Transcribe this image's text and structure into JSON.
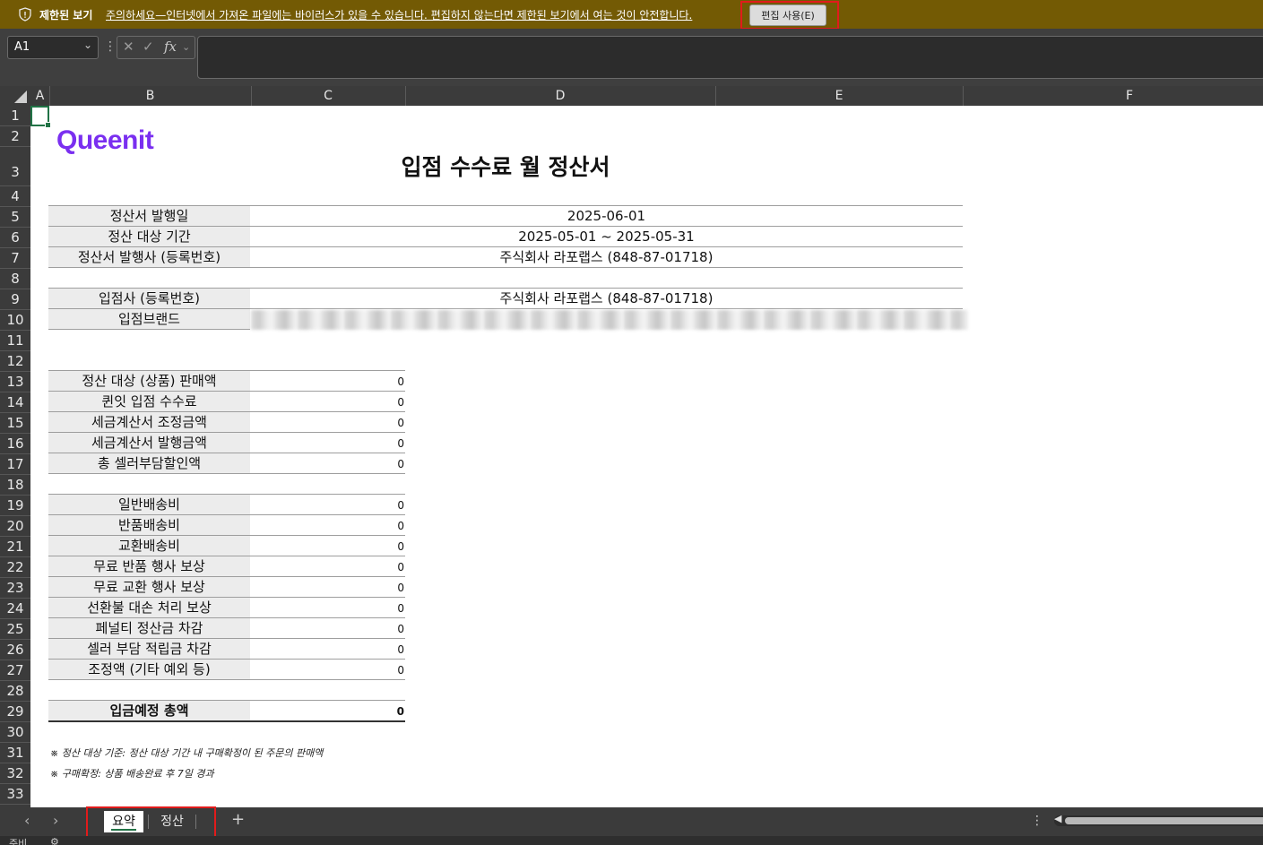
{
  "protected_view": {
    "title": "제한된 보기",
    "message": "주의하세요—인터넷에서 가져온 파일에는 바이러스가 있을 수 있습니다. 편집하지 않는다면 제한된 보기에서 여는 것이 안전합니다.",
    "enable_button": "편집 사용(E)",
    "bar_color": "#735a04"
  },
  "formula_bar": {
    "name_box": "A1",
    "fx_label": "fx",
    "formula": ""
  },
  "columns": [
    "A",
    "B",
    "C",
    "D",
    "E",
    "F"
  ],
  "rows": [
    "1",
    "2",
    "3",
    "4",
    "5",
    "6",
    "7",
    "8",
    "9",
    "10",
    "11",
    "12",
    "13",
    "14",
    "15",
    "16",
    "17",
    "18",
    "19",
    "20",
    "21",
    "22",
    "23",
    "24",
    "25",
    "26",
    "27",
    "28",
    "29",
    "30",
    "31",
    "32",
    "33"
  ],
  "sheet": {
    "logo": "Queenit",
    "logo_color": "#7a2ff0",
    "title": "입점 수수료 월 정산서",
    "info": [
      {
        "label": "정산서 발행일",
        "value": "2025-06-01"
      },
      {
        "label": "정산 대상 기간",
        "value": "2025-05-01 ~ 2025-05-31"
      },
      {
        "label": "정산서 발행사 (등록번호)",
        "value": "주식회사 라포랩스 (848-87-01718)"
      },
      {
        "label": "입점사 (등록번호)",
        "value": "주식회사 라포랩스 (848-87-01718)"
      },
      {
        "label": "입점브랜드",
        "value": ""
      }
    ],
    "sales": [
      {
        "label": "정산 대상 (상품) 판매액",
        "value": "0"
      },
      {
        "label": "퀸잇 입점 수수료",
        "value": "0"
      },
      {
        "label": "세금계산서 조정금액",
        "value": "0"
      },
      {
        "label": "세금계산서 발행금액",
        "value": "0"
      },
      {
        "label": "총 셀러부담할인액",
        "value": "0"
      }
    ],
    "shipping": [
      {
        "label": "일반배송비",
        "value": "0"
      },
      {
        "label": "반품배송비",
        "value": "0"
      },
      {
        "label": "교환배송비",
        "value": "0"
      },
      {
        "label": "무료 반품 행사 보상",
        "value": "0"
      },
      {
        "label": "무료 교환 행사 보상",
        "value": "0"
      },
      {
        "label": "선환불 대손 처리 보상",
        "value": "0"
      },
      {
        "label": "페널티 정산금 차감",
        "value": "0"
      },
      {
        "label": "셀러 부담 적립금 차감",
        "value": "0"
      },
      {
        "label": "조정액 (기타 예외 등)",
        "value": "0"
      }
    ],
    "total": {
      "label": "입금예정 총액",
      "value": "0"
    },
    "notes": [
      "※ 정산 대상 기준: 정산 대상 기간 내 구매확정이 된 주문의 판매액",
      "※ 구매확정: 상품 배송완료 후 7일 경과"
    ]
  },
  "tabs": [
    {
      "label": "요약",
      "active": true
    },
    {
      "label": "정산",
      "active": false
    }
  ],
  "status": {
    "ready": "준비"
  }
}
